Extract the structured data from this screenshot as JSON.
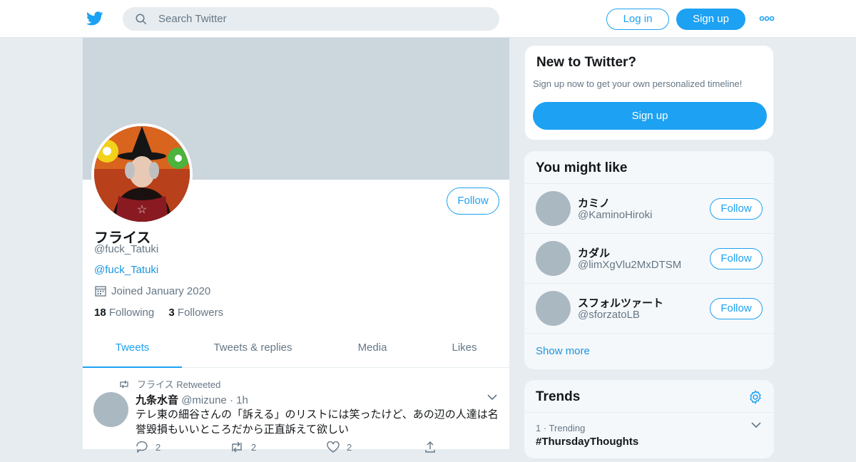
{
  "header": {
    "logo_icon": "twitter-bird-icon",
    "search_placeholder": "Search Twitter",
    "login_label": "Log in",
    "signup_label": "Sign up",
    "more_icon": "more-horizontal-icon",
    "brand_color": "#1da1f2"
  },
  "profile": {
    "display_name": "フライス",
    "handle": "@fuck_Tatuki",
    "bio_link": "@fuck_Tatuki",
    "joined": "Joined January 2020",
    "following_count": "18",
    "following_label": "Following",
    "followers_count": "3",
    "followers_label": "Followers",
    "follow_label": "Follow"
  },
  "tabs": [
    {
      "label": "Tweets",
      "active": true
    },
    {
      "label": "Tweets & replies",
      "active": false
    },
    {
      "label": "Media",
      "active": false
    },
    {
      "label": "Likes",
      "active": false
    }
  ],
  "tweet": {
    "retweeted_by": "フライス Retweeted",
    "author_name": "九条水音",
    "author_handle": "@mizune",
    "separator": "·",
    "time": "1h",
    "text": "テレ東の細谷さんの「訴える」のリストには笑ったけど、あの辺の人達は名誉毀損もいいところだから正直訴えて欲しい",
    "reply_count": "2",
    "retweet_count": "2",
    "like_count": "2"
  },
  "new_to_twitter": {
    "title": "New to Twitter?",
    "subtitle": "Sign up now to get your own personalized timeline!",
    "signup_label": "Sign up"
  },
  "you_might_like": {
    "title": "You might like",
    "users": [
      {
        "name": "カミノ",
        "handle": "@KaminoHiroki",
        "follow_label": "Follow"
      },
      {
        "name": "カダル",
        "handle": "@limXgVlu2MxDTSM",
        "follow_label": "Follow"
      },
      {
        "name": "スフォルツァート",
        "handle": "@sforzatoLB",
        "follow_label": "Follow"
      }
    ],
    "show_more": "Show more"
  },
  "trends": {
    "title": "Trends",
    "items": [
      {
        "meta": "1 · Trending",
        "name": "#ThursdayThoughts"
      }
    ]
  }
}
